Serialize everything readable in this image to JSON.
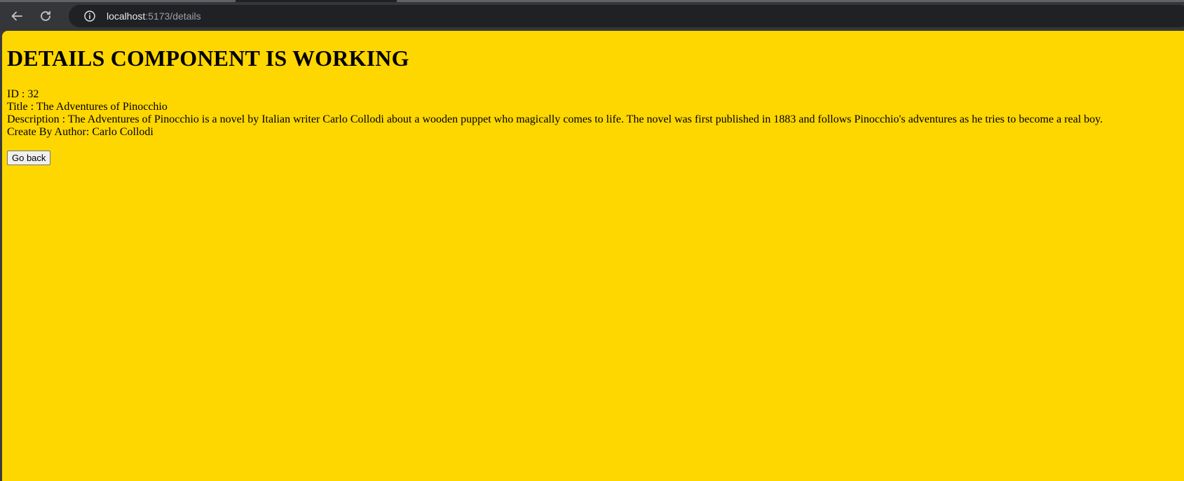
{
  "browser": {
    "url_host": "localhost",
    "url_path": ":5173/details",
    "back_icon": "arrow-left-icon",
    "reload_icon": "reload-icon",
    "info_icon": "info-circle-icon"
  },
  "colors": {
    "page_background": "#ffd700",
    "chrome_background": "#35363a",
    "omnibox_background": "#202124"
  },
  "page": {
    "heading": "DETAILS COMPONENT IS WORKING",
    "id_line": "ID : 32",
    "title_line": "Title : The Adventures of Pinocchio",
    "description_line": "Description : The Adventures of Pinocchio is a novel by Italian writer Carlo Collodi about a wooden puppet who magically comes to life. The novel was first published in 1883 and follows Pinocchio's adventures as he tries to become a real boy.",
    "author_line": "Create By Author: Carlo Collodi",
    "go_back_label": "Go back"
  }
}
